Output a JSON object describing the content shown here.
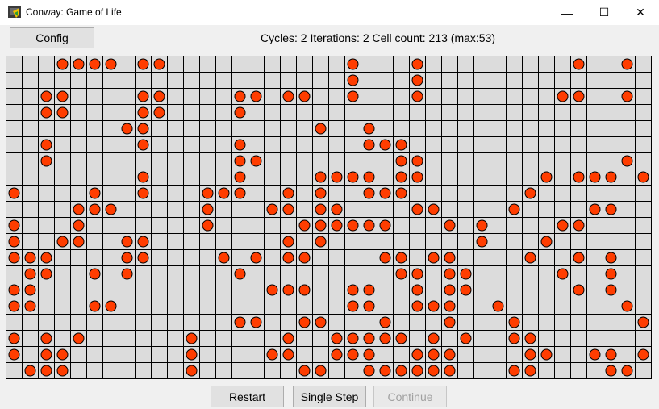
{
  "window": {
    "title": "Conway: Game of Life",
    "controls": {
      "minimize": "—",
      "maximize": "☐",
      "close": "✕"
    }
  },
  "toolbar": {
    "config_label": "Config",
    "status": "Cycles: 2 Iterations: 2 Cell count: 213 (max:53)"
  },
  "grid": {
    "cols": 40,
    "rows": 20,
    "cell_color": "#ff3d00",
    "cell_border": "#000000",
    "background": "#dcdcdc",
    "alive_rows": [
      [
        3,
        4,
        5,
        6,
        8,
        9,
        21,
        25,
        35,
        38
      ],
      [
        21,
        25
      ],
      [
        2,
        3,
        8,
        9,
        14,
        15,
        17,
        18,
        21,
        25,
        34,
        35,
        38
      ],
      [
        2,
        3,
        8,
        9,
        14
      ],
      [
        7,
        8,
        19,
        22
      ],
      [
        2,
        8,
        14,
        22,
        23,
        24
      ],
      [
        2,
        14,
        15,
        24,
        25,
        38
      ],
      [
        8,
        14,
        19,
        20,
        21,
        22,
        24,
        25,
        33,
        35,
        36,
        37,
        39
      ],
      [
        0,
        5,
        8,
        12,
        13,
        14,
        17,
        19,
        22,
        23,
        24,
        32
      ],
      [
        4,
        5,
        6,
        12,
        16,
        17,
        19,
        20,
        25,
        26,
        31,
        36,
        37
      ],
      [
        0,
        4,
        12,
        18,
        19,
        20,
        21,
        22,
        23,
        27,
        29,
        34,
        35
      ],
      [
        0,
        3,
        4,
        7,
        8,
        17,
        19,
        29,
        33
      ],
      [
        0,
        1,
        2,
        7,
        8,
        13,
        15,
        17,
        18,
        23,
        24,
        26,
        27,
        32,
        35,
        37
      ],
      [
        1,
        2,
        5,
        7,
        14,
        24,
        25,
        27,
        28,
        34,
        37
      ],
      [
        0,
        1,
        16,
        17,
        18,
        21,
        22,
        25,
        27,
        28,
        35,
        37
      ],
      [
        0,
        1,
        5,
        6,
        21,
        22,
        25,
        26,
        27,
        30,
        38
      ],
      [
        14,
        15,
        18,
        19,
        23,
        27,
        31,
        39
      ],
      [
        0,
        2,
        4,
        11,
        17,
        20,
        21,
        22,
        23,
        24,
        26,
        28,
        31,
        32
      ],
      [
        0,
        2,
        3,
        11,
        16,
        17,
        20,
        21,
        22,
        25,
        26,
        27,
        32,
        33,
        36,
        37,
        39
      ],
      [
        1,
        2,
        3,
        11,
        18,
        19,
        22,
        23,
        24,
        25,
        26,
        27,
        31,
        32,
        37,
        38
      ]
    ]
  },
  "buttons": {
    "restart": "Restart",
    "single_step": "Single Step",
    "continue": "Continue"
  }
}
